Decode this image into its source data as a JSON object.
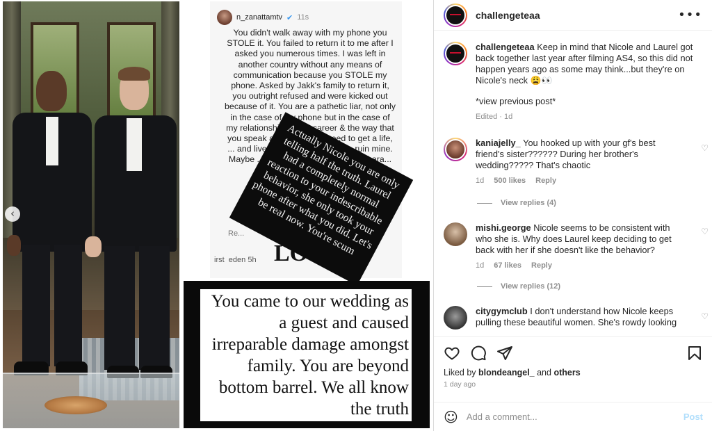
{
  "post": {
    "username": "challengeteaa",
    "more_icon": "more-horizontal-icon",
    "caption": {
      "username": "challengeteaa",
      "text": "Keep in mind that Nicole and Laurel got back together last year after filming AS4, so this did not happen years ago as some may think...but they're on Nicole's neck 😩👀",
      "extra": "*view previous post*",
      "meta": "Edited · 1d"
    },
    "likes_prefix": "Liked by",
    "likes_user": "blondeangel_",
    "likes_and": "and",
    "likes_others": "others",
    "date": "1 day ago"
  },
  "media": {
    "nav_prev": "‹",
    "story_user": "n_zanattamtv",
    "story_verified": "✔",
    "story_time": "11s",
    "story_text": "You didn't walk away with my phone you STOLE it. You failed to return it to me after I asked you numerous times. I was left in another country without any means of communication because you STOLE my phone. Asked by Jakk's family to return it, you outright refused and were kicked out because of it. You are a pathetic liar, not only in the case of my phone but in the case of my relationships & my career & the way that you speak about me. You need to get a life, ... and live the rest of your day ... ruin mine. Maybe ... happin... definit... leave ... hara... this...",
    "story_reply_hint": "Re...",
    "story_footer_a": "irst",
    "story_footer_b": "eden 5h",
    "big_letters": "LO",
    "overlay_text": "Actually Nicole you are only telling half the truth. Laurel had a completely normal reaction to your indescribable behavior, she only took your phone after what you did. Let's be real now. You're scum",
    "quote_text": "You came to our wedding as a guest and caused irreparable damage amongst family. You are beyond bottom barrel. We all know the truth"
  },
  "comments": [
    {
      "username": "kaniajelly_",
      "text": "You hooked up with your gf's best friend's sister?????? During her brother's wedding????? That's chaotic",
      "time": "1d",
      "likes": "500 likes",
      "reply": "Reply",
      "view_replies": "View replies (4)"
    },
    {
      "username": "mishi.george",
      "text": "Nicole seems to be consistent with who she is. Why does Laurel keep deciding to get back with her if she doesn't like the behavior?",
      "time": "1d",
      "likes": "67 likes",
      "reply": "Reply",
      "view_replies": "View replies (12)"
    },
    {
      "username": "citygymclub",
      "text": "I don't understand how Nicole keeps pulling these beautiful women. She's rowdy looking"
    }
  ],
  "icons": {
    "heart": "heart-icon",
    "comment": "comment-icon",
    "share": "share-icon",
    "save": "bookmark-icon",
    "emoji": "emoji-icon",
    "small_heart_glyph": "♡",
    "emoji_glyph": "☺"
  },
  "composer": {
    "placeholder": "Add a comment...",
    "post_label": "Post"
  },
  "colors": {
    "post_button_disabled": "#b2dffc",
    "muted": "#8e8e8e",
    "verified": "#3897f0"
  }
}
